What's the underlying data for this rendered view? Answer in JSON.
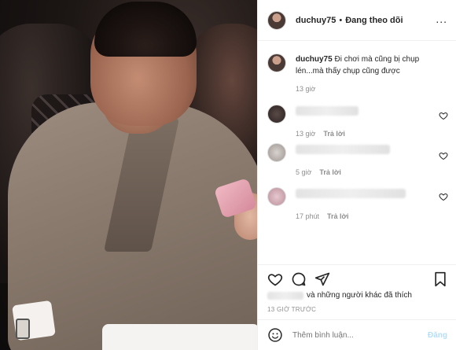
{
  "post": {
    "username": "duchuy75",
    "separator": "•",
    "follow_status": "Đang theo dõi",
    "more": "..."
  },
  "caption": {
    "username": "duchuy75",
    "text": "Đi chơi mà cũng bị chụp lén...mà thấy chụp cũng được",
    "time": "13 giờ"
  },
  "comments": [
    {
      "time": "13 giờ",
      "reply": "Trả lời"
    },
    {
      "time": "5 giờ",
      "reply": "Trả lời"
    },
    {
      "time": "17 phút",
      "reply": "Trả lời"
    }
  ],
  "likes": {
    "text": "và những người khác đã thích"
  },
  "post_time": "13 GIỜ TRƯỚC",
  "add_comment": {
    "placeholder": "Thêm bình luận...",
    "post_label": "Đăng"
  },
  "icons": {
    "like": "heart-icon",
    "comment": "comment-icon",
    "share": "share-icon",
    "save": "bookmark-icon",
    "emoji": "emoji-icon"
  },
  "colors": {
    "text": "#262626",
    "muted": "#8e8e8e",
    "post_button_disabled": "#b2dffc"
  }
}
